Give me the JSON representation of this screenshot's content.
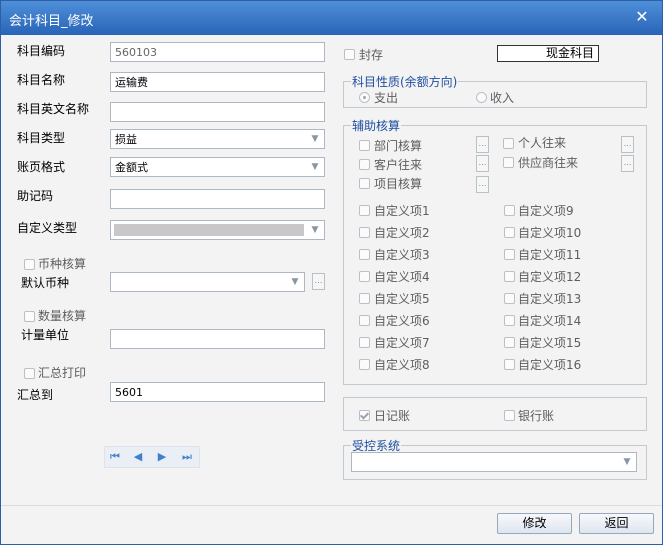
{
  "window": {
    "title": "会计科目_修改"
  },
  "form": {
    "subject_code": {
      "label": "科目编码",
      "value": "560103"
    },
    "subject_name": {
      "label": "科目名称",
      "value": "运输费"
    },
    "english_name": {
      "label": "科目英文名称",
      "value": ""
    },
    "subject_type": {
      "label": "科目类型",
      "value": "损益"
    },
    "ledger_format": {
      "label": "账页格式",
      "value": "金额式"
    },
    "mnemonic": {
      "label": "助记码",
      "value": ""
    },
    "custom_type": {
      "label": "自定义类型",
      "value": ""
    },
    "currency_accounting": {
      "label": "币种核算"
    },
    "default_currency": {
      "label": "默认币种",
      "value": ""
    },
    "quantity_accounting": {
      "label": "数量核算"
    },
    "unit": {
      "label": "计量单位",
      "value": ""
    },
    "summary_print": {
      "label": "汇总打印"
    },
    "summary_to": {
      "label": "汇总到",
      "value": "5601"
    }
  },
  "sealed": {
    "label": "封存"
  },
  "cash_subject": {
    "label": "现金科目"
  },
  "nature": {
    "title": "科目性质(余额方向)",
    "options": [
      {
        "label": "支出",
        "selected": true
      },
      {
        "label": "收入",
        "selected": false
      }
    ]
  },
  "aux": {
    "title": "辅助核算",
    "items": {
      "dept": "部门核算",
      "personal": "个人往来",
      "customer": "客户往来",
      "supplier": "供应商往来",
      "project": "项目核算"
    },
    "custom_left": [
      "自定义项1",
      "自定义项2",
      "自定义项3",
      "自定义项4",
      "自定义项5",
      "自定义项6",
      "自定义项7",
      "自定义项8"
    ],
    "custom_right": [
      "自定义项9",
      "自定义项10",
      "自定义项11",
      "自定义项12",
      "自定义项13",
      "自定义项14",
      "自定义项15",
      "自定义项16"
    ]
  },
  "journal": {
    "label": "日记账",
    "checked": true
  },
  "bank": {
    "label": "银行账"
  },
  "controlled": {
    "title": "受控系统",
    "value": ""
  },
  "nav": {
    "first": "first-record-icon",
    "prev": "prev-record-icon",
    "next": "next-record-icon",
    "last": "last-record-icon"
  },
  "buttons": {
    "modify": "修改",
    "back": "返回"
  }
}
